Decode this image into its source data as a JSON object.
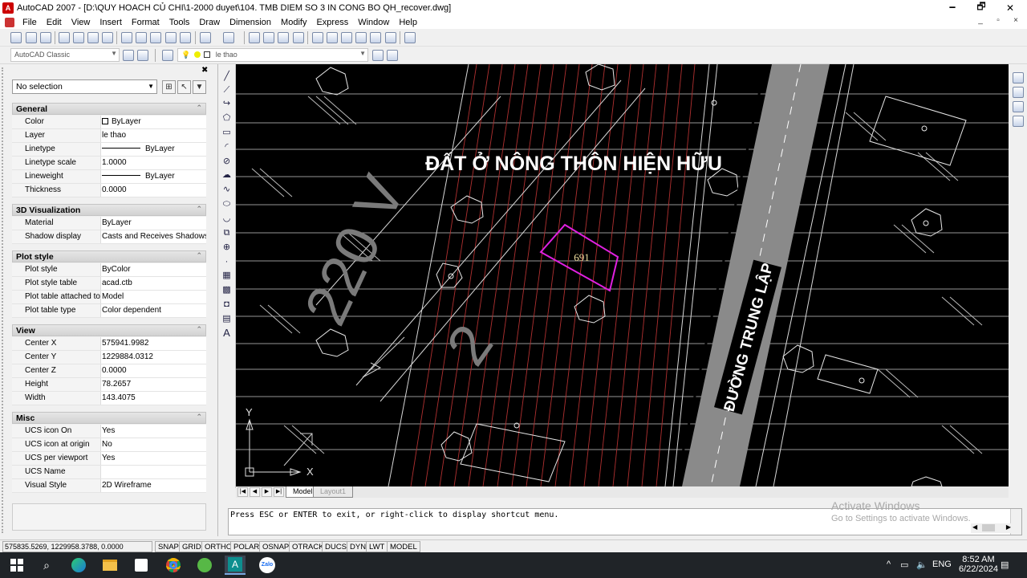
{
  "window": {
    "title": "AutoCAD 2007 - [D:\\QUY HOACH CỦ CHI\\1-2000 duyet\\104. TMB DIEM SO 3 IN CONG BO QH_recover.dwg]",
    "minimize": "🗕",
    "restore": "🗗",
    "close": "✕"
  },
  "menu": [
    "File",
    "Edit",
    "View",
    "Insert",
    "Format",
    "Tools",
    "Draw",
    "Dimension",
    "Modify",
    "Express",
    "Window",
    "Help"
  ],
  "toolbar": {
    "workspace": "AutoCAD Classic",
    "layer": "le thao"
  },
  "properties": {
    "selection": "No selection",
    "sections": [
      {
        "title": "General",
        "rows": [
          {
            "k": "Color",
            "v": "ByLayer"
          },
          {
            "k": "Layer",
            "v": "le thao"
          },
          {
            "k": "Linetype",
            "v": "ByLayer"
          },
          {
            "k": "Linetype scale",
            "v": "1.0000"
          },
          {
            "k": "Lineweight",
            "v": "ByLayer"
          },
          {
            "k": "Thickness",
            "v": "0.0000"
          }
        ]
      },
      {
        "title": "3D Visualization",
        "rows": [
          {
            "k": "Material",
            "v": "ByLayer"
          },
          {
            "k": "Shadow display",
            "v": "Casts and Receives Shadows"
          }
        ]
      },
      {
        "title": "Plot style",
        "rows": [
          {
            "k": "Plot style",
            "v": "ByColor"
          },
          {
            "k": "Plot style table",
            "v": "acad.ctb"
          },
          {
            "k": "Plot table attached to",
            "v": "Model"
          },
          {
            "k": "Plot table type",
            "v": "Color dependent"
          }
        ]
      },
      {
        "title": "View",
        "rows": [
          {
            "k": "Center X",
            "v": "575941.9982"
          },
          {
            "k": "Center Y",
            "v": "1229884.0312"
          },
          {
            "k": "Center Z",
            "v": "0.0000"
          },
          {
            "k": "Height",
            "v": "78.2657"
          },
          {
            "k": "Width",
            "v": "143.4075"
          }
        ]
      },
      {
        "title": "Misc",
        "rows": [
          {
            "k": "UCS icon On",
            "v": "Yes"
          },
          {
            "k": "UCS icon at origin",
            "v": "No"
          },
          {
            "k": "UCS per viewport",
            "v": "Yes"
          },
          {
            "k": "UCS Name",
            "v": ""
          },
          {
            "k": "Visual Style",
            "v": "2D Wireframe"
          }
        ]
      }
    ]
  },
  "drawing": {
    "main_label": "ĐẤT Ở NÔNG THÔN HIỆN HỮU",
    "voltage_label": "220 V",
    "lot_number": "691",
    "road_label": "ĐƯỜNG TRUNG LẬP",
    "big_digit": "2",
    "ucs_y": "Y",
    "ucs_x": "X",
    "colors": {
      "lot_outline": "#e020e0",
      "road_fill": "#8a8a8a",
      "road_text_bg": "#000000",
      "hatch": "#c8c8c8",
      "grid_red": "#b03030"
    }
  },
  "tabs": {
    "model": "Model",
    "layout1": "Layout1"
  },
  "command": {
    "text": "Press ESC or ENTER to exit, or right-click to display shortcut menu."
  },
  "watermark": {
    "line1": "Activate Windows",
    "line2": "Go to Settings to activate Windows."
  },
  "status": {
    "coords": "575835.5269, 1229958.3788, 0.0000",
    "buttons": [
      "SNAP",
      "GRID",
      "ORTHO",
      "POLAR",
      "OSNAP",
      "OTRACK",
      "DUCS",
      "DYN",
      "LWT",
      "MODEL"
    ]
  },
  "taskbar": {
    "time": "8:52 AM",
    "date": "6/22/2024",
    "lang": "ENG"
  }
}
